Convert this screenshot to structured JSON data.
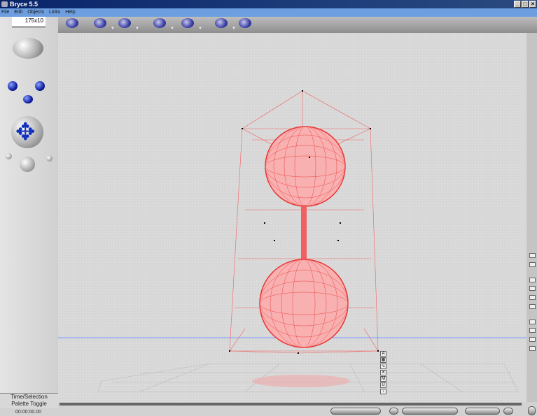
{
  "window": {
    "title": "Bryce 5.5",
    "minimize": "_",
    "maximize": "□",
    "close": "×"
  },
  "menu": [
    "File",
    "Edit",
    "Objects",
    "Links",
    "Help"
  ],
  "left_palette": {
    "size_readout": "175x10",
    "toggle_label_1": "Time/Selection",
    "toggle_label_2": "Palette Toggle",
    "timecode": "00:00:00.00"
  },
  "create_tools": [
    "cube-object",
    "sphere-cluster",
    "torus",
    "pyramid-lights",
    "cylinder-link",
    "group-grid",
    "box-terrain"
  ],
  "view_tools": [
    "A",
    "▦",
    "↘",
    "✕",
    "M",
    "U",
    "↓"
  ],
  "colors": {
    "wireframe": "#f04040",
    "titlebar": "#0a246a",
    "menubar": "#6d9fe0",
    "ground_line": "#6080ff"
  }
}
